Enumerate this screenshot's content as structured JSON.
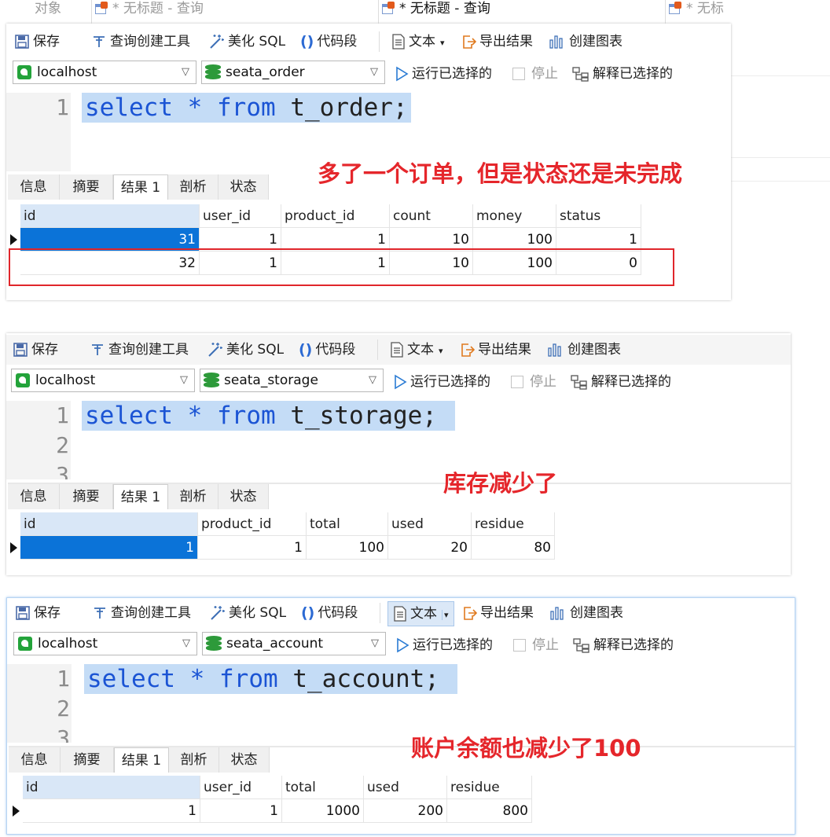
{
  "tabs": [
    {
      "label": "对象",
      "active": false
    },
    {
      "label": "* 无标题 - 查询",
      "active": false
    },
    {
      "label": "* 无标题 - 查询",
      "active": true
    },
    {
      "label": "* 无标",
      "active": false
    }
  ],
  "toolbar": {
    "save": "保存",
    "query_builder": "查询创建工具",
    "beautify": "美化 SQL",
    "snippet": "代码段",
    "text": "文本",
    "export": "导出结果",
    "chart": "创建图表",
    "run_selected": "运行已选择的",
    "stop": "停止",
    "explain_selected": "解释已选择的"
  },
  "panels": [
    {
      "connection": "localhost",
      "database": "seata_order",
      "sql": {
        "kw1": "select",
        "op": "*",
        "kw2": "from",
        "table": "t_order;"
      },
      "line_numbers": [
        "1"
      ],
      "result_tabs": [
        "信息",
        "摘要",
        "结果 1",
        "剖析",
        "状态"
      ],
      "columns": [
        "id",
        "user_id",
        "product_id",
        "count",
        "money",
        "status"
      ],
      "rows": [
        [
          "31",
          "1",
          "1",
          "10",
          "100",
          "1"
        ],
        [
          "32",
          "1",
          "1",
          "10",
          "100",
          "0"
        ]
      ],
      "annotation": "多了一个订单，但是状态还是未完成"
    },
    {
      "connection": "localhost",
      "database": "seata_storage",
      "sql": {
        "kw1": "select",
        "op": "*",
        "kw2": "from",
        "table": "t_storage;"
      },
      "line_numbers": [
        "1",
        "2",
        "3"
      ],
      "result_tabs": [
        "信息",
        "摘要",
        "结果 1",
        "剖析",
        "状态"
      ],
      "columns": [
        "id",
        "product_id",
        "total",
        "used",
        "residue"
      ],
      "rows": [
        [
          "1",
          "1",
          "100",
          "20",
          "80"
        ]
      ],
      "annotation": "库存减少了"
    },
    {
      "connection": "localhost",
      "database": "seata_account",
      "sql": {
        "kw1": "select",
        "op": "*",
        "kw2": "from",
        "table": "t_account;"
      },
      "line_numbers": [
        "1",
        "2",
        "3"
      ],
      "result_tabs": [
        "信息",
        "摘要",
        "结果 1",
        "剖析",
        "状态"
      ],
      "columns": [
        "id",
        "user_id",
        "total",
        "used",
        "residue"
      ],
      "rows": [
        [
          "1",
          "1",
          "1000",
          "200",
          "800"
        ]
      ],
      "annotation": "账户余额也减少了100"
    }
  ]
}
